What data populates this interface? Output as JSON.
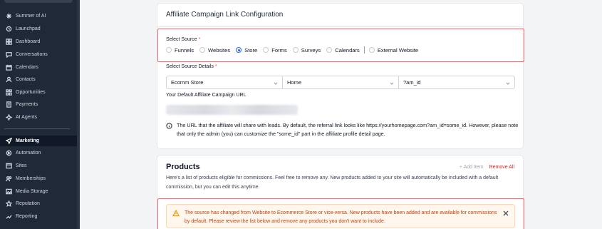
{
  "sidebar": {
    "items": [
      {
        "label": "Summer of AI",
        "icon": "sparkle-icon"
      },
      {
        "label": "Launchpad",
        "icon": "launchpad-icon"
      },
      {
        "label": "Dashboard",
        "icon": "dashboard-icon"
      },
      {
        "label": "Conversations",
        "icon": "chat-icon"
      },
      {
        "label": "Calendars",
        "icon": "calendar-icon"
      },
      {
        "label": "Contacts",
        "icon": "contacts-icon"
      },
      {
        "label": "Opportunities",
        "icon": "opportunities-icon"
      },
      {
        "label": "Payments",
        "icon": "payments-icon"
      },
      {
        "label": "AI Agents",
        "icon": "ai-agents-icon"
      },
      {
        "label": "Marketing",
        "icon": "marketing-icon",
        "active": true
      },
      {
        "label": "Automation",
        "icon": "automation-icon"
      },
      {
        "label": "Sites",
        "icon": "sites-icon"
      },
      {
        "label": "Memberships",
        "icon": "memberships-icon"
      },
      {
        "label": "Media Storage",
        "icon": "media-storage-icon"
      },
      {
        "label": "Reputation",
        "icon": "reputation-icon"
      },
      {
        "label": "Reporting",
        "icon": "reporting-icon"
      }
    ]
  },
  "config": {
    "title": "Affiliate Campaign Link Configuration",
    "select_source_label": "Select Source",
    "required_mark": "*",
    "sources": [
      "Funnels",
      "Websites",
      "Store",
      "Forms",
      "Surveys",
      "Calendars",
      "External Website"
    ],
    "selected_source": "Store",
    "source_details_label": "Select Source Details",
    "detail_selects": [
      "Ecomm Store",
      "Home",
      "?am_id"
    ],
    "default_url_label": "Your Default Affiliate Campaign URL",
    "info_text": "The URL that the affiliate will share with leads. By default, the referral link looks like https://yourhomepage.com?am_id=some_id. However, please note that only the admin (you) can customize the \"some_id\" part in the affiliate profile detail page."
  },
  "products": {
    "title": "Products",
    "add_item": "+ Add Item",
    "remove_all": "Remove All",
    "description": "Here's a list of products eligible for commissions. Feel free to remove any. New products added to your site will automatically be included with a default commission, but you can edit this anytime.",
    "warning": "The source has changed from Website to Ecommerce Store or vice-versa. New products have been added and are available for commissions by default. Please review the list below and remove any products you don't want to include."
  },
  "colors": {
    "sidebar_bg": "#1f2937",
    "accent": "#2563eb",
    "danger": "#dc2626",
    "warning_text": "#c2410c",
    "highlight_border": "#ef6b6b"
  }
}
